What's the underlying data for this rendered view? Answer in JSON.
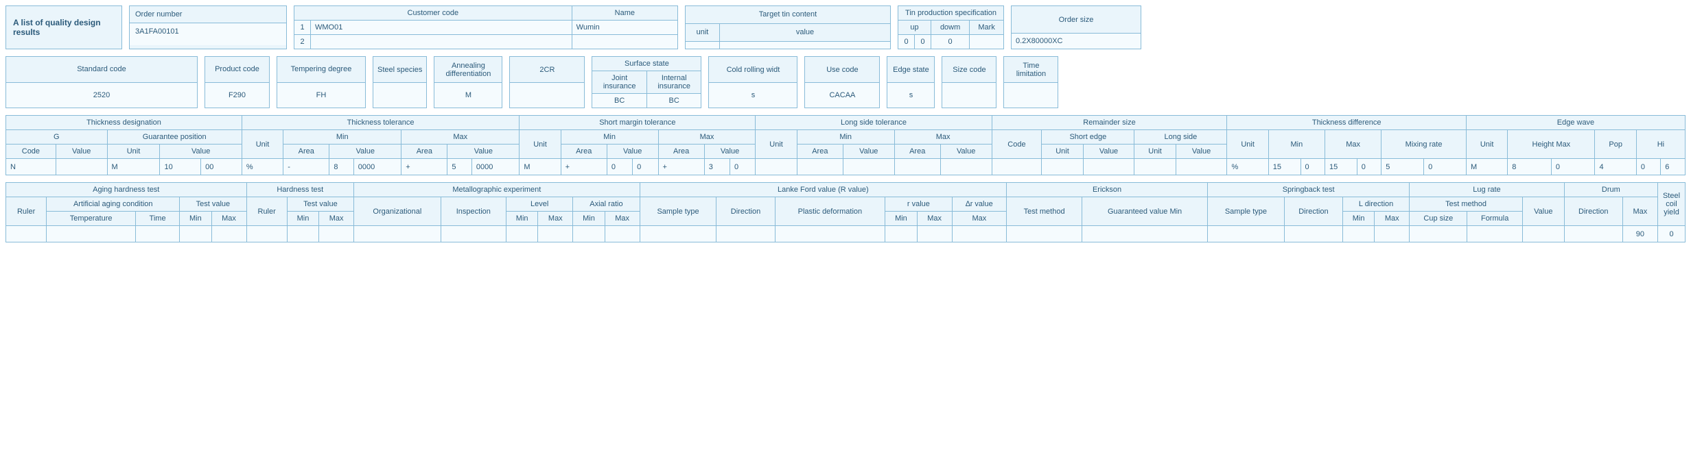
{
  "title": "A list of quality design results",
  "order_number": {
    "label": "Order number",
    "value": "3A1FA00101"
  },
  "customer": {
    "code_label": "Customer code",
    "name_label": "Name",
    "rows": [
      {
        "idx": "1",
        "code": "WMO01",
        "name": "Wumin"
      },
      {
        "idx": "2",
        "code": "",
        "name": ""
      }
    ]
  },
  "target_tin": {
    "label": "Target tin content",
    "unit_label": "unit",
    "value_label": "value",
    "unit": "",
    "value": ""
  },
  "tin_prod": {
    "label": "Tin production specification",
    "up_label": "up",
    "down_label": "dowm",
    "mark_label": "Mark",
    "up1": "0",
    "up2": "0",
    "down": "0",
    "mark": ""
  },
  "order_size": {
    "label": "Order size",
    "value": "0.2X80000XC"
  },
  "spec": {
    "standard_code": {
      "label": "Standard code",
      "value": "2520"
    },
    "product_code": {
      "label": "Product code",
      "value": "F290"
    },
    "tempering_degree": {
      "label": "Tempering degree",
      "value": "FH"
    },
    "steel_species": {
      "label": "Steel species",
      "value": ""
    },
    "annealing": {
      "label": "Annealing differentiation",
      "value": "M"
    },
    "cr2": {
      "label": "2CR",
      "value": ""
    },
    "surface_state": {
      "label": "Surface state",
      "joint_label": "Joint insurance",
      "internal_label": "Internal insurance",
      "joint": "BC",
      "internal": "BC"
    },
    "cold_rolling": {
      "label": "Cold rolling widt",
      "value": "s"
    },
    "use_code": {
      "label": "Use code",
      "value": "CACAA"
    },
    "edge_state": {
      "label": "Edge state",
      "value": "s"
    },
    "size_code": {
      "label": "Size code",
      "value": ""
    },
    "time_limitation": {
      "label": "Time limitation",
      "value": ""
    }
  },
  "tol": {
    "thickness_designation": "Thickness designation",
    "g": "G",
    "code": "Code",
    "value": "Value",
    "guarantee_position": "Guarantee position",
    "unit": "Unit",
    "thickness_tolerance": "Thickness tolerance",
    "min": "Min",
    "max": "Max",
    "area": "Area",
    "short_margin": "Short margin tolerance",
    "long_side_tol": "Long side tolerance",
    "remainder_size": "Remainder size",
    "short_edge": "Short edge",
    "long_side": "Long side",
    "thickness_diff": "Thickness difference",
    "mixing_rate": "Mixing rate",
    "edge_wave": "Edge wave",
    "height_max": "Height Max",
    "pop": "Pop",
    "hi": "Hi",
    "row": {
      "code": "N",
      "value": "",
      "gp_unit": "M",
      "gp_val1": "10",
      "gp_val2": "00",
      "tt_unit": "%",
      "tt_min_area": "-",
      "tt_min_val1": "8",
      "tt_min_val2": "0000",
      "tt_max_area": "+",
      "tt_max_val1": "5",
      "tt_max_val2": "0000",
      "sm_unit": "M",
      "sm_min_area": "+",
      "sm_min_val1": "0",
      "sm_min_val2": "0",
      "sm_max_area": "+",
      "sm_max_val1": "3",
      "sm_max_val2": "0",
      "ls_unit": "",
      "ls_min_area": "",
      "ls_min_val": "",
      "ls_max_area": "",
      "ls_max_val": "",
      "rs_code": "",
      "rs_se_unit": "",
      "rs_se_val": "",
      "rs_ls_unit": "",
      "rs_ls_val": "",
      "td_unit": "%",
      "td_min1": "15",
      "td_min2": "0",
      "td_max1": "15",
      "td_max2": "0",
      "td_mix1": "5",
      "td_mix2": "0",
      "ew_unit": "M",
      "ew_h1": "8",
      "ew_h2": "0",
      "ew_pop": "4",
      "ew_hi1": "0",
      "ew_hi2": "6"
    }
  },
  "tests": {
    "aging_hardness": "Aging hardness test",
    "ruler": "Ruler",
    "artificial_aging": "Artificial aging condition",
    "temperature": "Temperature",
    "time": "Time",
    "test_value": "Test value",
    "min": "Min",
    "max": "Max",
    "hardness_test": "Hardness test",
    "metallographic": "Metallographic experiment",
    "organizational": "Organizational",
    "inspection": "Inspection",
    "level": "Level",
    "axial_ratio": "Axial ratio",
    "lanke_ford": "Lanke Ford value (R value)",
    "sample_type": "Sample type",
    "direction": "Direction",
    "plastic_deformation": "Plastic deformation",
    "r_value": "r value",
    "delta_r": "∆r value",
    "erickson": "Erickson",
    "test_method": "Test method",
    "guaranteed_min": "Guaranteed value Min",
    "springback": "Springback test",
    "l_direction": "L direction",
    "lug_rate": "Lug rate",
    "cup_size": "Cup size",
    "formula": "Formula",
    "value": "Value",
    "drum": "Drum",
    "steel_coil_yield": "Steel coil yield",
    "row": {
      "drum_max": "90",
      "scy": "0"
    }
  }
}
